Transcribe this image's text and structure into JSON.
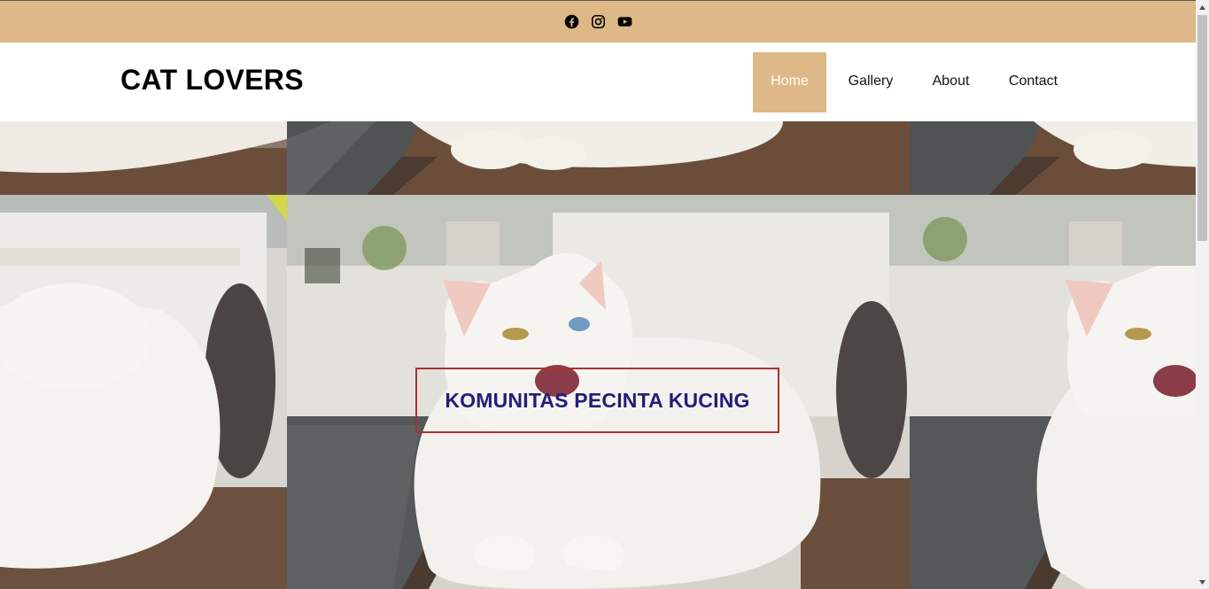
{
  "social": {
    "icons": [
      "facebook-icon",
      "instagram-icon",
      "youtube-icon"
    ]
  },
  "header": {
    "logo": "CAT LOVERS",
    "nav": [
      "Home",
      "Gallery",
      "About",
      "Contact"
    ],
    "active_index": 0
  },
  "hero": {
    "banner_text": "KOMUNITAS PECINTA KUCING"
  },
  "colors": {
    "accent": "#deb887",
    "banner_text": "#1f1f7a",
    "banner_border": "#a83236"
  }
}
